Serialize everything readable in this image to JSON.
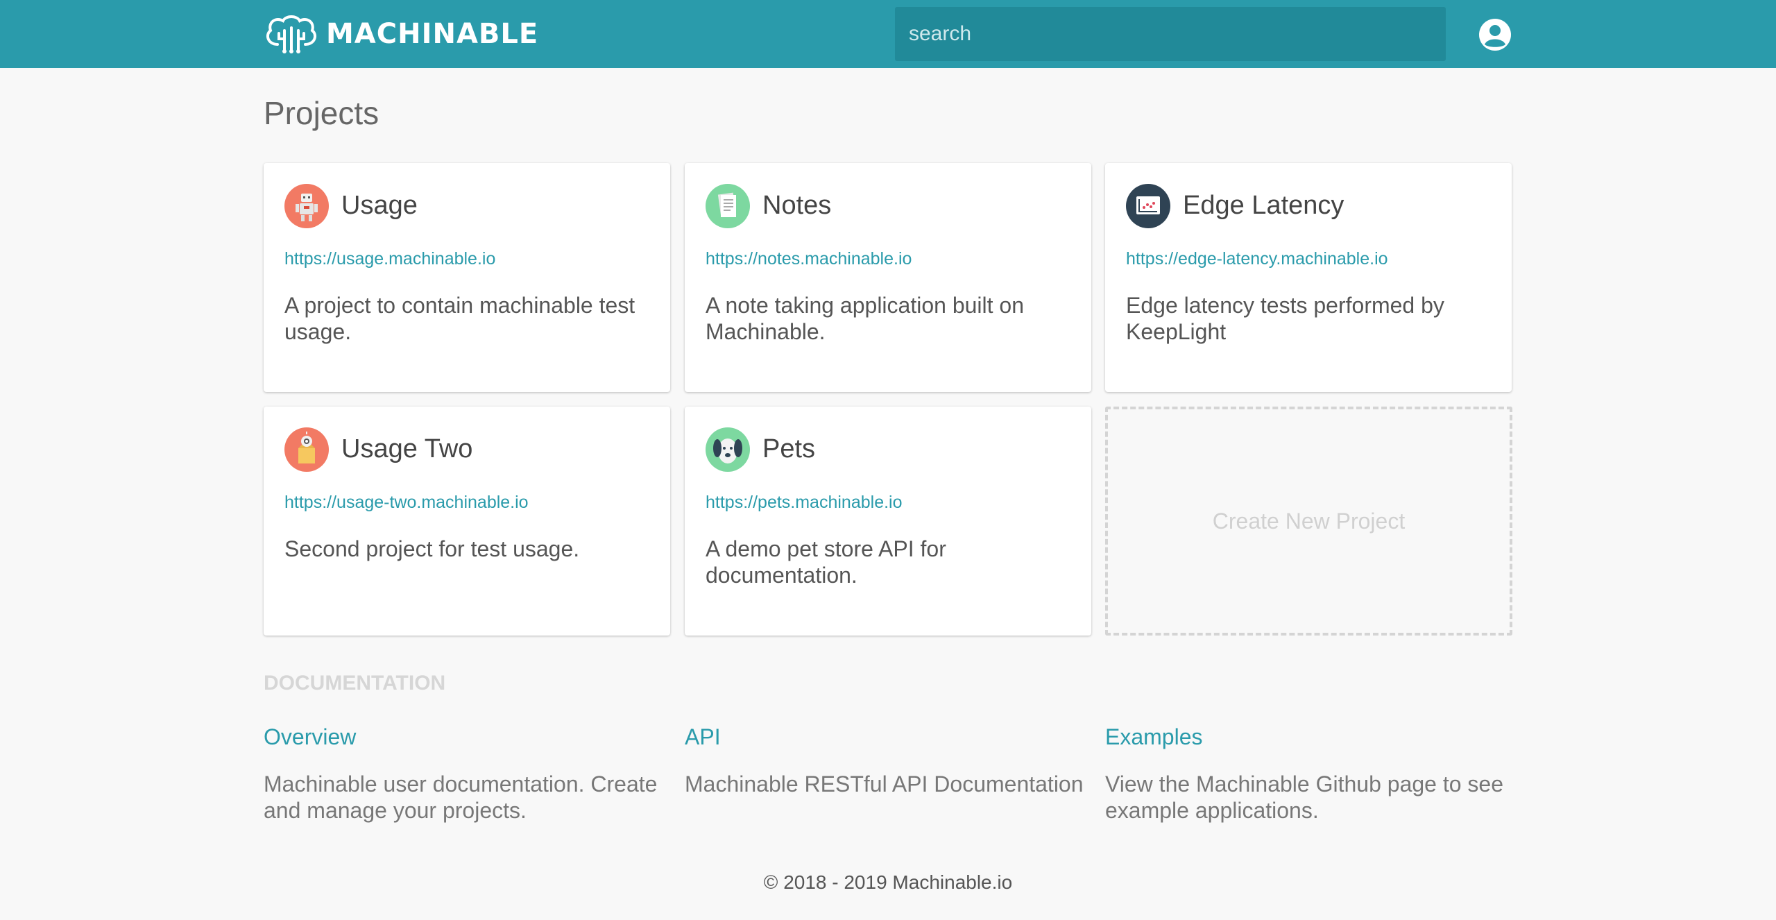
{
  "header": {
    "logo_text": "MACHINABLE",
    "search_placeholder": "search"
  },
  "page": {
    "title": "Projects"
  },
  "projects": [
    {
      "name": "Usage",
      "url": "https://usage.machinable.io",
      "description": "A project to contain machinable test usage.",
      "icon": "robot-icon",
      "icon_color": "#f27a64"
    },
    {
      "name": "Notes",
      "url": "https://notes.machinable.io",
      "description": "A note taking application built on Machinable.",
      "icon": "notes-icon",
      "icon_color": "#7dd8a0"
    },
    {
      "name": "Edge Latency",
      "url": "https://edge-latency.machinable.io",
      "description": "Edge latency tests performed by KeepLight",
      "icon": "chart-icon",
      "icon_color": "#2f4354"
    },
    {
      "name": "Usage Two",
      "url": "https://usage-two.machinable.io",
      "description": "Second project for test usage.",
      "icon": "box-robot-icon",
      "icon_color": "#f27a64"
    },
    {
      "name": "Pets",
      "url": "https://pets.machinable.io",
      "description": "A demo pet store API for documentation.",
      "icon": "dog-icon",
      "icon_color": "#7dd8a0"
    }
  ],
  "create_project_label": "Create New Project",
  "documentation": {
    "heading": "DOCUMENTATION",
    "items": [
      {
        "title": "Overview",
        "description": "Machinable user documentation. Create and manage your projects."
      },
      {
        "title": "API",
        "description": "Machinable RESTful API Documentation"
      },
      {
        "title": "Examples",
        "description": "View the Machinable Github page to see example applications."
      }
    ]
  },
  "footer": {
    "copyright": "© 2018 - 2019 Machinable.io"
  },
  "colors": {
    "accent": "#2a9bab",
    "search_bg": "#218a99",
    "page_bg": "#f8f8f8"
  }
}
